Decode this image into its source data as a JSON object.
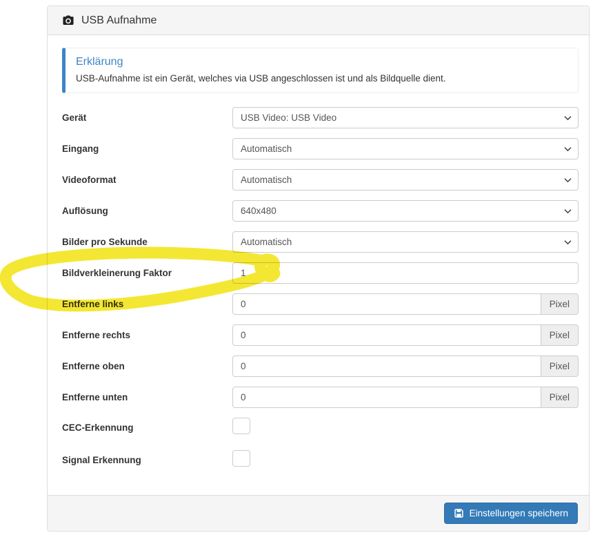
{
  "panel": {
    "title": "USB Aufnahme",
    "title_icon": "camera-icon",
    "callout": {
      "title": "Erklärung",
      "text": "USB-Aufnahme ist ein Gerät, welches via USB angeschlossen ist und als Bildquelle dient."
    },
    "fields": [
      {
        "id": "geraet",
        "label": "Gerät",
        "type": "select",
        "value": "USB Video: USB Video"
      },
      {
        "id": "eingang",
        "label": "Eingang",
        "type": "select",
        "value": "Automatisch"
      },
      {
        "id": "videoformat",
        "label": "Videoformat",
        "type": "select",
        "value": "Automatisch"
      },
      {
        "id": "aufloesung",
        "label": "Auflösung",
        "type": "select",
        "value": "640x480"
      },
      {
        "id": "bilder-pro-sekunde",
        "label": "Bilder pro Sekunde",
        "type": "select",
        "value": "Automatisch"
      },
      {
        "id": "bildverkleinerung-faktor",
        "label": "Bildverkleinerung Faktor",
        "type": "text",
        "value": "1",
        "highlighted": true
      },
      {
        "id": "entferne-links",
        "label": "Entferne links",
        "type": "text",
        "value": "0",
        "addon": "Pixel"
      },
      {
        "id": "entferne-rechts",
        "label": "Entferne rechts",
        "type": "text",
        "value": "0",
        "addon": "Pixel"
      },
      {
        "id": "entferne-oben",
        "label": "Entferne oben",
        "type": "text",
        "value": "0",
        "addon": "Pixel"
      },
      {
        "id": "entferne-unten",
        "label": "Entferne unten",
        "type": "text",
        "value": "0",
        "addon": "Pixel"
      },
      {
        "id": "cec-erkennung",
        "label": "CEC-Erkennung",
        "type": "checkbox",
        "checked": false
      },
      {
        "id": "signal-erkennung",
        "label": "Signal Erkennung",
        "type": "checkbox",
        "checked": false
      }
    ],
    "footer": {
      "save_button": "Einstellungen speichern",
      "save_icon": "save-icon"
    }
  },
  "annotation": {
    "type": "hand-drawn-marker-circle",
    "target": "bildverkleinerung-faktor"
  },
  "colors": {
    "accent_blue": "#3d84c6",
    "button_blue": "#337ab7",
    "panel_border": "#dddddd",
    "heading_bg": "#f5f5f5",
    "addon_bg": "#eeeeee",
    "highlight_yellow": "#f2e206"
  }
}
